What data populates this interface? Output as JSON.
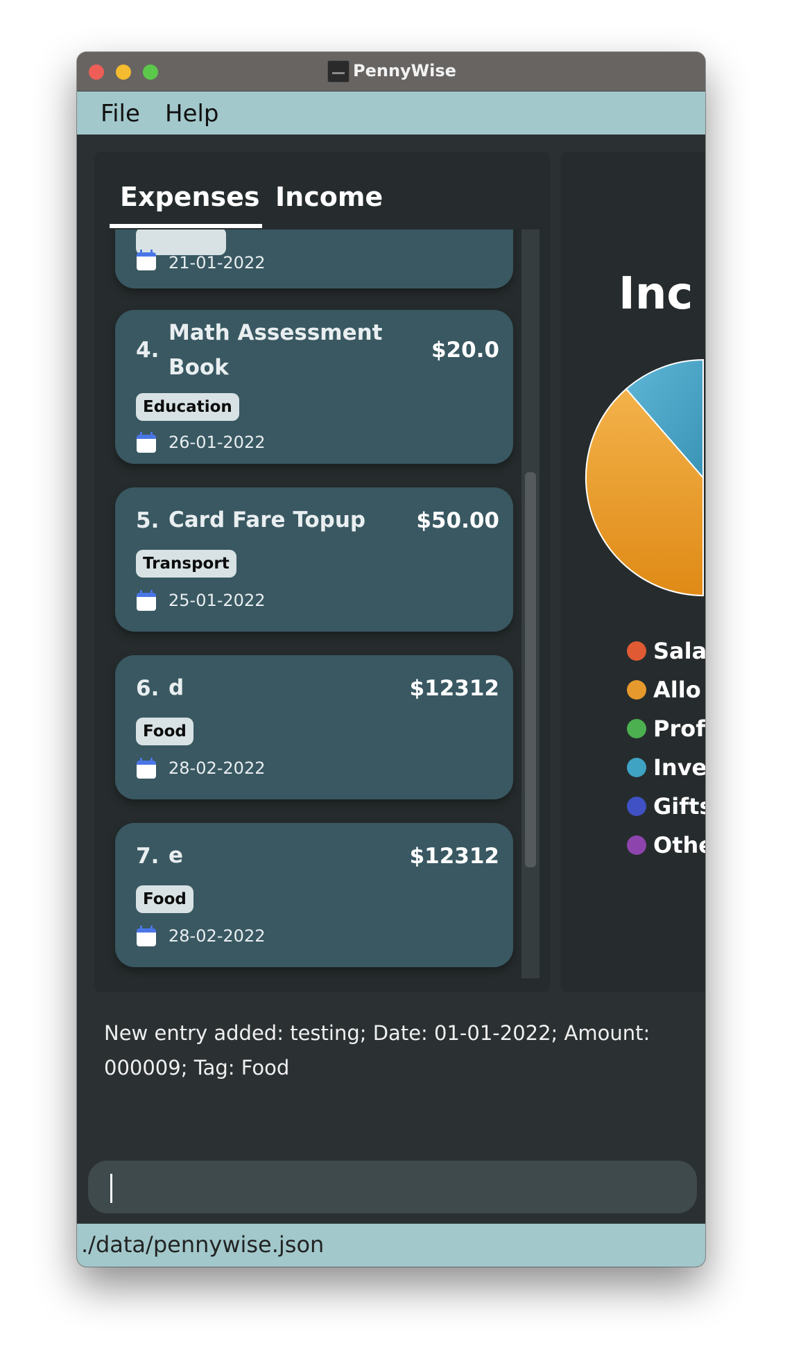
{
  "window": {
    "title": "PennyWise"
  },
  "menu": {
    "file": "File",
    "help": "Help"
  },
  "tabs": {
    "expenses": "Expenses",
    "income": "Income"
  },
  "entries": [
    {
      "index": "",
      "description": "",
      "amount": "",
      "tag": "",
      "date": "21-01-2022"
    },
    {
      "index": "4.",
      "description": "Math Assessment Book",
      "amount": "$20.0",
      "tag": "Education",
      "date": "26-01-2022"
    },
    {
      "index": "5.",
      "description": "Card Fare Topup",
      "amount": "$50.00",
      "tag": "Transport",
      "date": "25-01-2022"
    },
    {
      "index": "6.",
      "description": "d",
      "amount": "$12312",
      "tag": "Food",
      "date": "28-02-2022"
    },
    {
      "index": "7.",
      "description": "e",
      "amount": "$12312",
      "tag": "Food",
      "date": "28-02-2022"
    }
  ],
  "chart": {
    "title": "Inc",
    "legend": [
      {
        "label": "Sala",
        "color": "#e05a34"
      },
      {
        "label": "Allo",
        "color": "#e6992c"
      },
      {
        "label": "Profi",
        "color": "#4caf50"
      },
      {
        "label": "Inve",
        "color": "#3fa3c4"
      },
      {
        "label": "Gifts",
        "color": "#3f51c4"
      },
      {
        "label": "Othe",
        "color": "#8e44ad"
      }
    ]
  },
  "result_message": "New entry added: testing; Date: 01-01-2022; Amount: 000009; Tag: Food",
  "command_input": {
    "value": ""
  },
  "status_bar": {
    "path": "./data/pennywise.json"
  }
}
